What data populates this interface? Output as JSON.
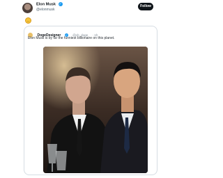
{
  "tweet": {
    "author_name": "Elon Musk",
    "author_handle": "@elonmusk",
    "follow_label": "Follow",
    "emoji": "🙂"
  },
  "quoted": {
    "author_name": "DogeDesigner",
    "author_handle": "@cb_doge",
    "time": "· 1h",
    "text": "Elon Musk is by far the funniest billionaire on this planet."
  },
  "icons": {
    "verified": "verified-badge-icon"
  },
  "colors": {
    "verified_blue": "#1d9bf0",
    "follow_button": "#0f1419"
  }
}
